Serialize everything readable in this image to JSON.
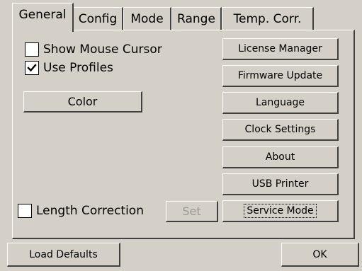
{
  "tabs": [
    {
      "label": "General",
      "active": true
    },
    {
      "label": "Config",
      "active": false
    },
    {
      "label": "Mode",
      "active": false
    },
    {
      "label": "Range",
      "active": false
    },
    {
      "label": "Temp. Corr.",
      "active": false
    }
  ],
  "general": {
    "show_mouse_cursor": {
      "label": "Show Mouse Cursor",
      "checked": false
    },
    "use_profiles": {
      "label": "Use Profiles",
      "checked": true
    },
    "color_button": "Color",
    "length_correction": {
      "label": "Length Correction",
      "checked": false
    },
    "set_button": "Set",
    "side_buttons": {
      "license_manager": "License Manager",
      "firmware_update": "Firmware Update",
      "language": "Language",
      "clock_settings": "Clock Settings",
      "about": "About",
      "usb_printer": "USB Printer",
      "service_mode": "Service Mode"
    }
  },
  "footer": {
    "load_defaults": "Load Defaults",
    "ok": "OK"
  },
  "icons": {
    "checkmark": "checkmark-icon"
  }
}
